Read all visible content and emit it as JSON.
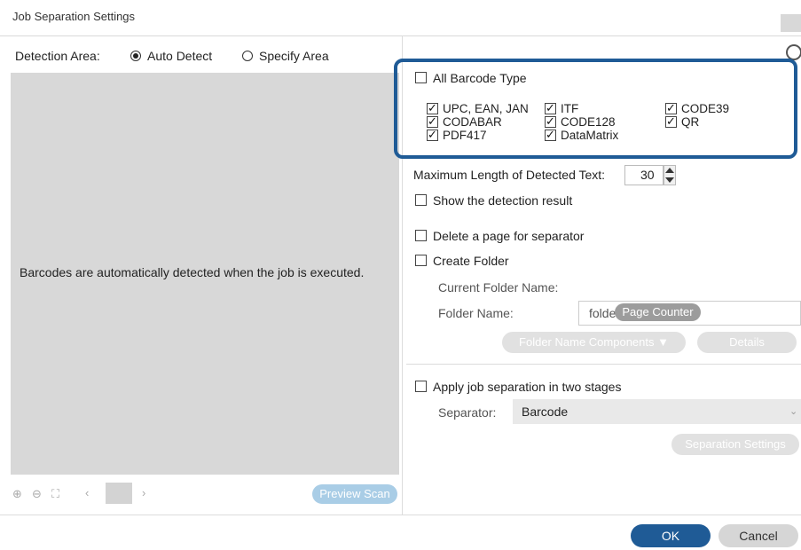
{
  "window": {
    "title": "Job Separation Settings"
  },
  "detection": {
    "label": "Detection Area:",
    "auto_detect": "Auto Detect",
    "specify_area": "Specify Area",
    "selected": "Auto Detect"
  },
  "preview": {
    "message": "Barcodes are automatically detected when the job is executed.",
    "preview_scan_label": "Preview Scan"
  },
  "barcodes": {
    "all_label": "All Barcode Type",
    "all_checked": false,
    "types": [
      {
        "label": "UPC, EAN, JAN",
        "checked": true
      },
      {
        "label": "ITF",
        "checked": true
      },
      {
        "label": "CODE39",
        "checked": true
      },
      {
        "label": "CODABAR",
        "checked": true
      },
      {
        "label": "CODE128",
        "checked": true
      },
      {
        "label": "QR",
        "checked": true
      },
      {
        "label": "PDF417",
        "checked": true
      },
      {
        "label": "DataMatrix",
        "checked": true
      }
    ]
  },
  "max_length": {
    "label": "Maximum Length of Detected Text:",
    "value": "30"
  },
  "options": {
    "show_detection": "Show the detection result",
    "delete_page": "Delete a page for separator",
    "create_folder": "Create Folder"
  },
  "folder": {
    "current_label": "Current Folder Name:",
    "name_label": "Folder Name:",
    "name_prefix": "folder",
    "name_component": "Page Counter",
    "components_button": "Folder Name Components ▼",
    "details_button": "Details"
  },
  "two_stage": {
    "label": "Apply job separation in two stages",
    "separator_label": "Separator:",
    "separator_value": "Barcode",
    "settings_button": "Separation Settings"
  },
  "footer": {
    "ok": "OK",
    "cancel": "Cancel"
  },
  "colors": {
    "accent": "#1f5b96",
    "preview_bg": "#d8d8d8",
    "disabled_button": "#e1e1e1"
  }
}
